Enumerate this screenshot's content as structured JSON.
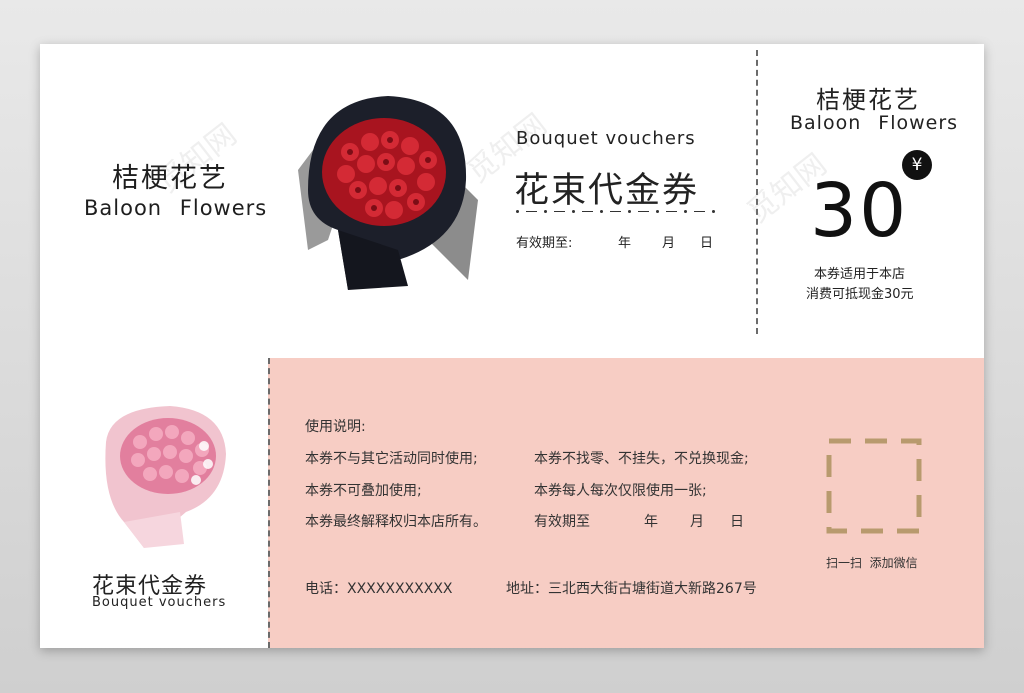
{
  "brand": {
    "cn": "桔梗花艺",
    "en": "Baloon Flowers"
  },
  "voucher": {
    "en_title": "Bouquet vouchers",
    "cn_title": "花束代金券",
    "validity_label": "有效期至:",
    "year": "年",
    "month": "月",
    "day": "日"
  },
  "stub": {
    "brand_cn": "桔梗花艺",
    "brand_en": "Baloon Flowers",
    "currency": "¥",
    "amount": "30",
    "note1": "本券适用于本店",
    "note2": "消费可抵现金30元"
  },
  "bottom_left": {
    "cn_title": "花束代金券",
    "en_title": "Bouquet vouchers"
  },
  "instructions": {
    "heading": "使用说明:",
    "rule1": "本券不与其它活动同时使用;",
    "rule2": "本券不找零、不挂失，不兑换现金;",
    "rule3": "本券不可叠加使用;",
    "rule4": "本券每人每次仅限使用一张;",
    "rule5": "本券最终解释权归本店所有。",
    "validity_label": "有效期至",
    "year": "年",
    "month": "月",
    "day": "日"
  },
  "contact": {
    "phone_label": "电话：XXXXXXXXXXX",
    "address_label": "地址：三北西大街古塘街道大新路267号"
  },
  "qr": {
    "caption": "扫一扫  添加微信"
  },
  "watermark": "觅知网",
  "colors": {
    "pink_panel": "#f7cdc4",
    "qr_frame": "#b89a6e",
    "rose_red": "#c8202c",
    "rose_pink": "#e88aa6"
  }
}
